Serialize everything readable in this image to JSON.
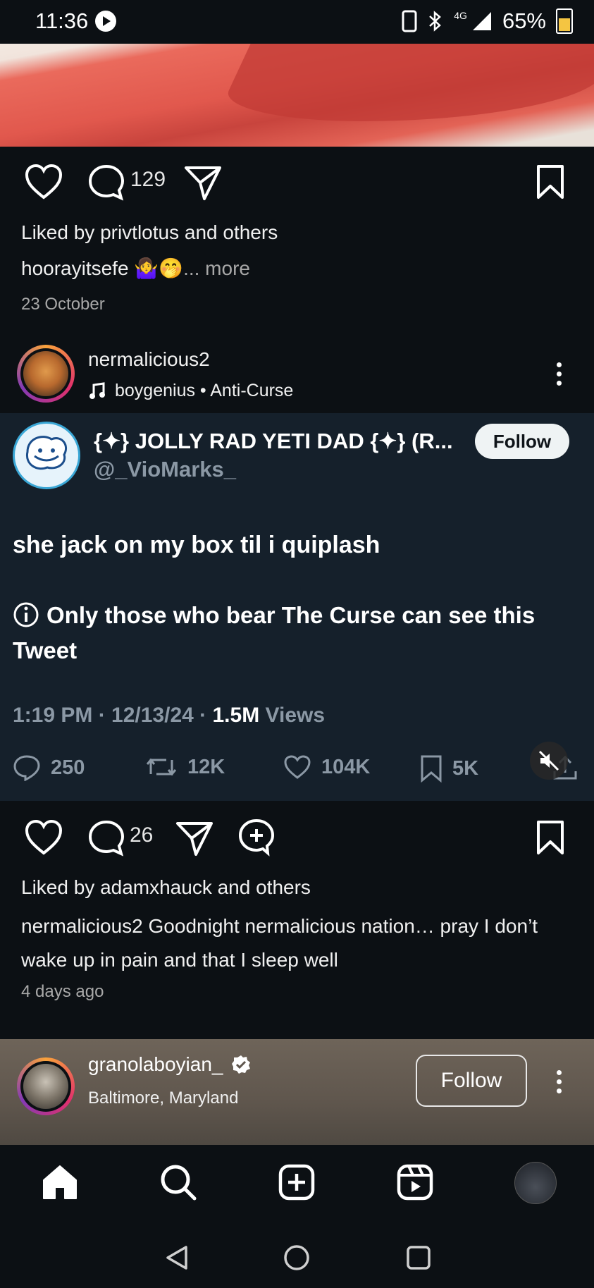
{
  "status_bar": {
    "time": "11:36",
    "network": "4G",
    "battery": "65%"
  },
  "post1": {
    "comment_count": "129",
    "liked_by": "Liked by privtlotus and others",
    "caption_user": "hoorayitsefe",
    "caption_emoji": "🤷‍♀️🤭",
    "more_label": "... more",
    "date": "23 October"
  },
  "post2": {
    "username": "nermalicious2",
    "music": "boygenius • Anti-Curse",
    "comment_count": "26",
    "liked_by": "Liked by adamxhauck and others",
    "caption_user": "nermalicious2",
    "caption_text": " Goodnight nermalicious nation… pray I don’t wake up in pain and that I sleep well",
    "date": "4 days ago"
  },
  "tweet": {
    "display_name": "{✦} JOLLY RAD YETI DAD {✦} (R...",
    "handle": "@_VioMarks_",
    "follow_label": "Follow",
    "body": "she jack on my box til i quiplash",
    "notice": "Only those who bear The Curse can see this Tweet",
    "time": "1:19 PM · 12/13/24 · ",
    "views_count": "1.5M",
    "views_label": " Views",
    "replies": "250",
    "retweets": "12K",
    "likes": "104K",
    "bookmarks": "5K"
  },
  "post3": {
    "username": "granolaboyian_",
    "location": "Baltimore, Maryland",
    "follow_label": "Follow"
  },
  "icons": {
    "like": "heart-icon",
    "comment": "comment-icon",
    "share": "send-icon",
    "save": "bookmark-icon",
    "remix": "add-comment-icon",
    "mute": "muted-speaker-icon"
  }
}
